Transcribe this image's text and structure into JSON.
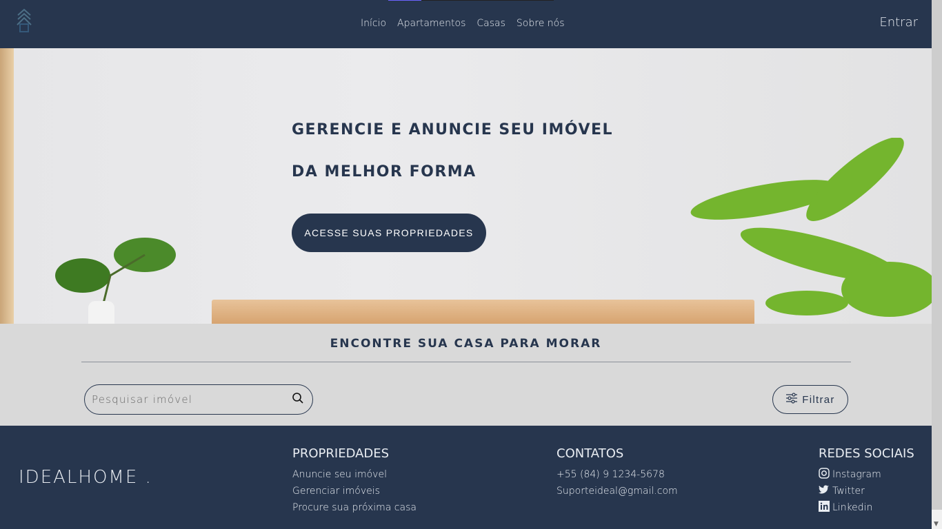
{
  "nav": {
    "items": [
      "Início",
      "Apartamentos",
      "Casas",
      "Sobre nós"
    ],
    "login": "Entrar"
  },
  "hero": {
    "line1": "GERENCIE E ANUNCIE SEU IMÓVEL",
    "line2": "DA MELHOR FORMA",
    "cta": "ACESSE SUAS PROPRIEDADES"
  },
  "search": {
    "title": "ENCONTRE SUA CASA PARA MORAR",
    "placeholder": "Pesquisar imóvel",
    "filter": "Filtrar"
  },
  "footer": {
    "brand": "IDEALHOME .",
    "columns": [
      {
        "title": "PROPRIEDADES",
        "links": [
          "Anuncie seu imóvel",
          "Gerenciar imóveis",
          "Procure sua próxima casa"
        ]
      },
      {
        "title": "CONTATOS",
        "links": [
          "+55 (84) 9 1234-5678",
          "Suporteideal@gmail.com"
        ]
      },
      {
        "title": "REDES SOCIAIS",
        "links": [
          "Instagram",
          "Twitter",
          "Linkedin"
        ]
      }
    ]
  },
  "colors": {
    "primary": "#27364e",
    "background": "#d9d9d9"
  }
}
